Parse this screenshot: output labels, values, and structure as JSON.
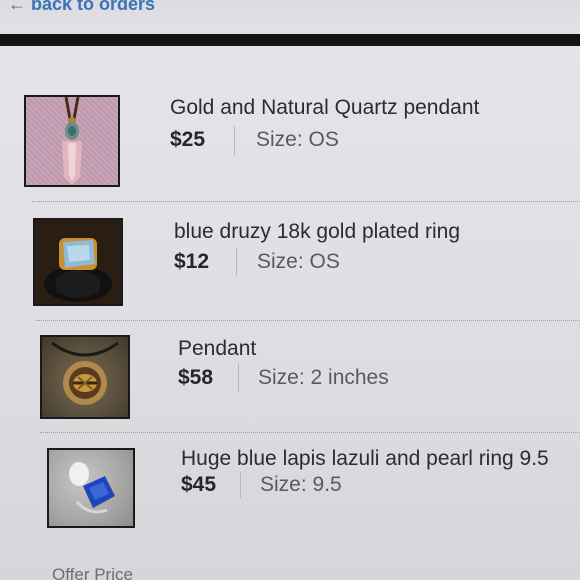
{
  "nav": {
    "back_arrow": "←",
    "back_label": "back to orders"
  },
  "items": [
    {
      "title": "Gold and Natural Quartz pendant",
      "price": "$25",
      "size": "Size: OS",
      "thumb_icon": "quartz-pendant-photo"
    },
    {
      "title": "blue druzy 18k gold plated ring",
      "price": "$12",
      "size": "Size: OS",
      "thumb_icon": "druzy-ring-photo"
    },
    {
      "title": "Pendant",
      "price": "$58",
      "size": "Size: 2 inches",
      "thumb_icon": "pendant-photo"
    },
    {
      "title": "Huge blue lapis lazuli and pearl ring 9.5",
      "price": "$45",
      "size": "Size: 9.5",
      "thumb_icon": "lapis-ring-photo"
    }
  ],
  "footer": {
    "offer_price_label": "Offer Price"
  },
  "colors": {
    "link": "#3a73b8",
    "header_bar": "#141416",
    "background": "#e2e1e6"
  }
}
